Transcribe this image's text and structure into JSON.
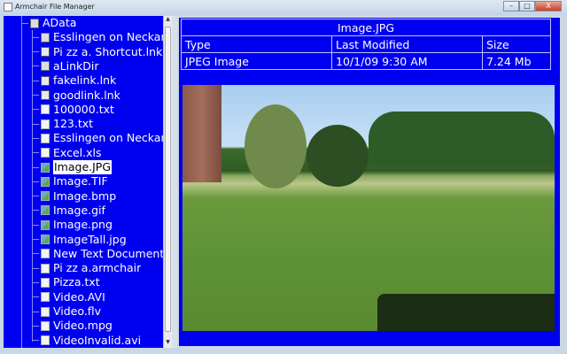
{
  "window": {
    "title": "Armchair File Manager",
    "minimize": "–",
    "maximize": "□",
    "close": "X"
  },
  "tree": {
    "root": "AData",
    "items": [
      {
        "label": "Esslingen on Neckar",
        "icon": "folder-icon"
      },
      {
        "label": "Pi zz a. Shortcut.lnk",
        "icon": "link-icon"
      },
      {
        "label": "aLinkDir",
        "icon": "folder-icon"
      },
      {
        "label": "fakelink.lnk",
        "icon": "link-icon"
      },
      {
        "label": "goodlink.lnk",
        "icon": "link-icon"
      },
      {
        "label": "100000.txt",
        "icon": "file-icon"
      },
      {
        "label": "123.txt",
        "icon": "file-icon"
      },
      {
        "label": "Esslingen on Neckar",
        "icon": "file-icon"
      },
      {
        "label": "Excel.xls",
        "icon": "file-icon"
      },
      {
        "label": "Image.JPG",
        "icon": "image-icon",
        "selected": true
      },
      {
        "label": "Image.TIF",
        "icon": "image-icon"
      },
      {
        "label": "Image.bmp",
        "icon": "image-icon"
      },
      {
        "label": "Image.gif",
        "icon": "image-icon"
      },
      {
        "label": "Image.png",
        "icon": "image-icon"
      },
      {
        "label": "ImageTall.jpg",
        "icon": "image-icon"
      },
      {
        "label": "New Text Document",
        "icon": "file-icon"
      },
      {
        "label": "Pi zz a.armchair",
        "icon": "file-icon"
      },
      {
        "label": "Pizza.txt",
        "icon": "file-icon"
      },
      {
        "label": "Video.AVI",
        "icon": "file-icon"
      },
      {
        "label": "Video.flv",
        "icon": "file-icon"
      },
      {
        "label": "Video.mpg",
        "icon": "file-icon"
      },
      {
        "label": "VideoInvalid.avi",
        "icon": "file-icon"
      }
    ]
  },
  "details": {
    "filename": "Image.JPG",
    "headers": [
      "Type",
      "Last Modified",
      "Size"
    ],
    "values": [
      "JPEG Image",
      "10/1/09 9:30 AM",
      "7.24 Mb"
    ]
  }
}
